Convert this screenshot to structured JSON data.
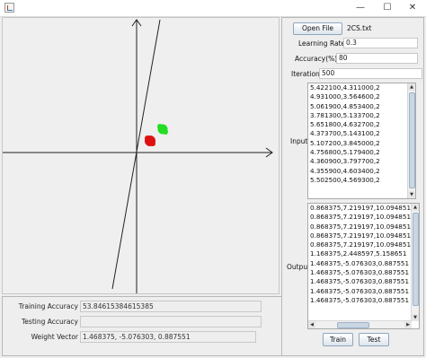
{
  "window": {
    "minimize_glyph": "—",
    "maximize_glyph": "☐",
    "close_glyph": "✕",
    "icon": "java-app-icon"
  },
  "plot": {
    "green_point_color": "#22dd22",
    "red_point_color": "#dd1111",
    "axis_color": "#222222",
    "line_color": "#222222"
  },
  "bottom": {
    "training_accuracy_label": "Training Accuracy",
    "training_accuracy_value": "53.84615384615385",
    "testing_accuracy_label": "Testing Accuracy",
    "testing_accuracy_value": "",
    "weight_vector_label": "Weight Vector",
    "weight_vector_value": "1.468375, -5.076303, 0.887551"
  },
  "controls": {
    "open_file_label": "Open File",
    "file_name": "2CS.txt",
    "learning_rate_label": "Learning Rate",
    "learning_rate_value": "0.3",
    "accuracy_label": "Accuracy(%)",
    "accuracy_value": "80",
    "iteration_label": "Iteration",
    "iteration_value": "500",
    "input_label": "Input",
    "output_label": "Output",
    "train_label": "Train",
    "test_label": "Test"
  },
  "input_rows": [
    "5.422100,4.311000,2",
    "4.931000,3.564600,2",
    "5.061900,4.853400,2",
    "3.781300,5.133700,2",
    "5.651800,4.632700,2",
    "4.373700,5.143100,2",
    "5.107200,3.845000,2",
    "4.756800,5.179400,2",
    "4.360900,3.797700,2",
    "4.355900,4.603400,2",
    "5.502500,4.569300,2"
  ],
  "output_rows": [
    "0.868375,7.219197,10.094851",
    "0.868375,7.219197,10.094851",
    "0.868375,7.219197,10.094851",
    "0.868375,7.219197,10.094851",
    "0.868375,7.219197,10.094851",
    "1.168375,2.448597,5.158651",
    "1.468375,-5.076303,0.887551",
    "1.468375,-5.076303,0.887551",
    "1.468375,-5.076303,0.887551",
    "1.468375,-5.076303,0.887551",
    "1.468375,-5.076303,0.887551"
  ]
}
